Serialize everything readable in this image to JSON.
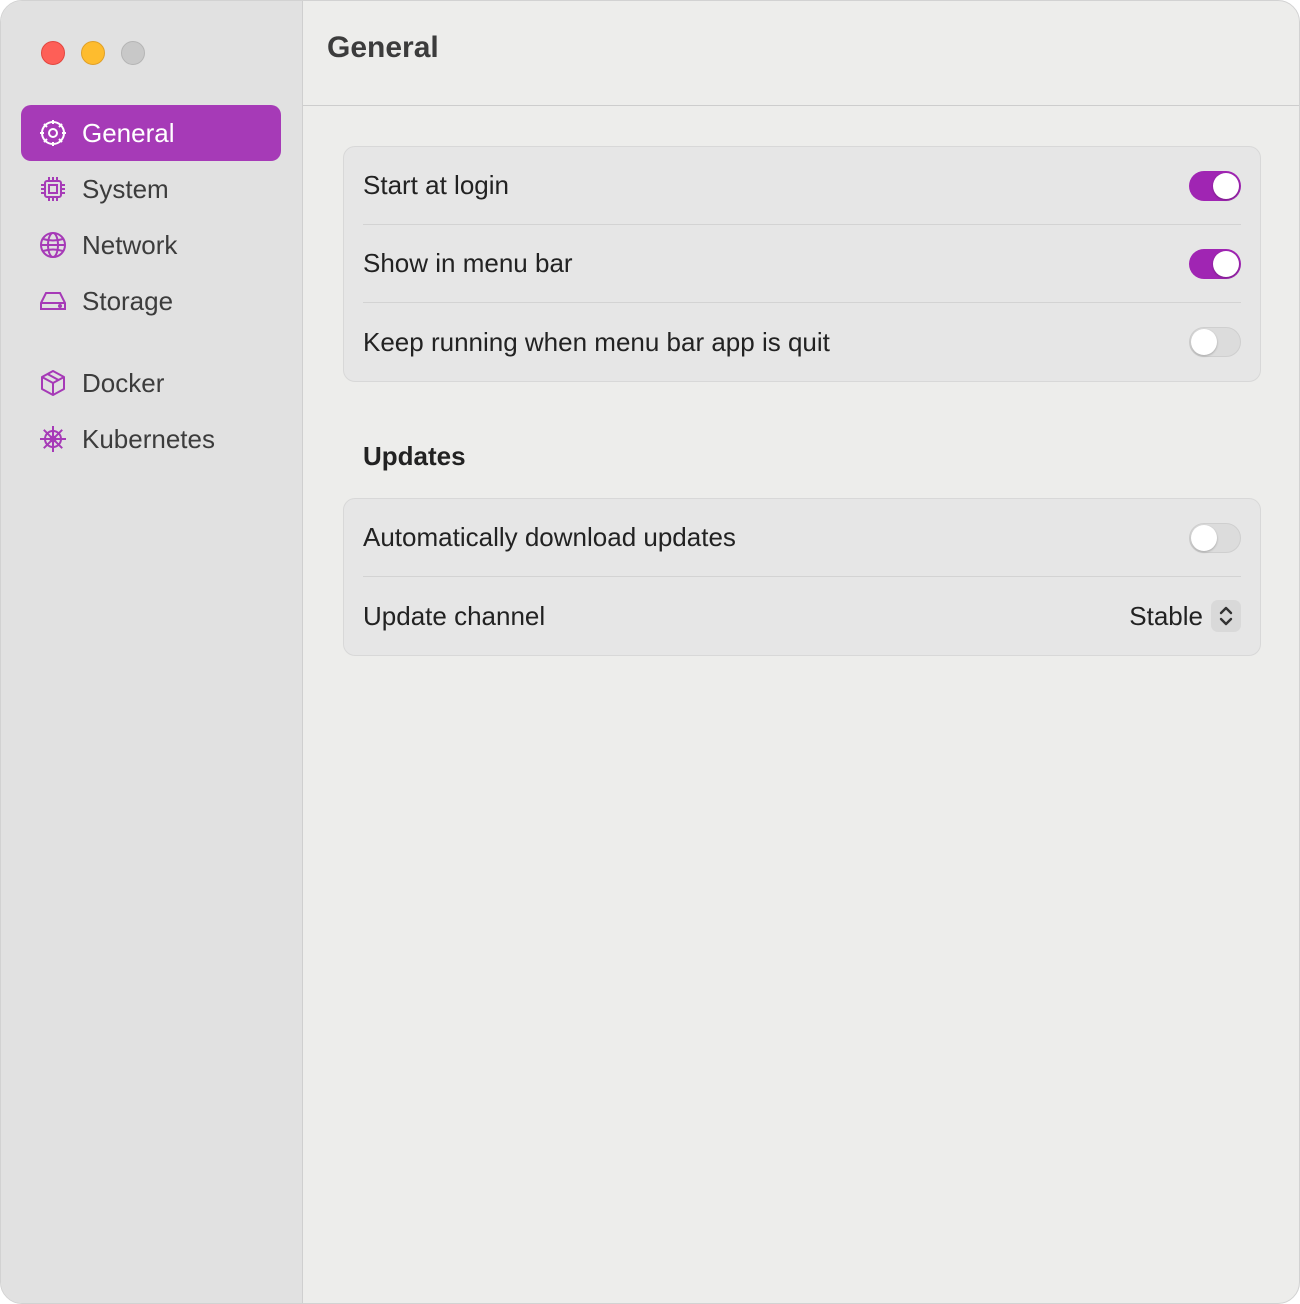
{
  "sidebar": {
    "items": [
      {
        "label": "General",
        "icon": "gear-icon",
        "active": true
      },
      {
        "label": "System",
        "icon": "cpu-icon"
      },
      {
        "label": "Network",
        "icon": "globe-icon"
      },
      {
        "label": "Storage",
        "icon": "drive-icon"
      },
      {
        "label": "Docker",
        "icon": "box-icon"
      },
      {
        "label": "Kubernetes",
        "icon": "helm-icon"
      }
    ]
  },
  "header": {
    "title": "General"
  },
  "general_group": {
    "rows": [
      {
        "label": "Start at login",
        "enabled": true
      },
      {
        "label": "Show in menu bar",
        "enabled": true
      },
      {
        "label": "Keep running when menu bar app is quit",
        "enabled": false
      }
    ]
  },
  "updates": {
    "title": "Updates",
    "rows": [
      {
        "label": "Automatically download updates",
        "enabled": false
      },
      {
        "label": "Update channel",
        "value": "Stable"
      }
    ]
  },
  "colors": {
    "accent": "#a025b3",
    "sidebar_active": "#a63ab7",
    "close": "#fe5f57",
    "minimize": "#febc2e",
    "zoom_disabled": "#c8c8c8"
  }
}
